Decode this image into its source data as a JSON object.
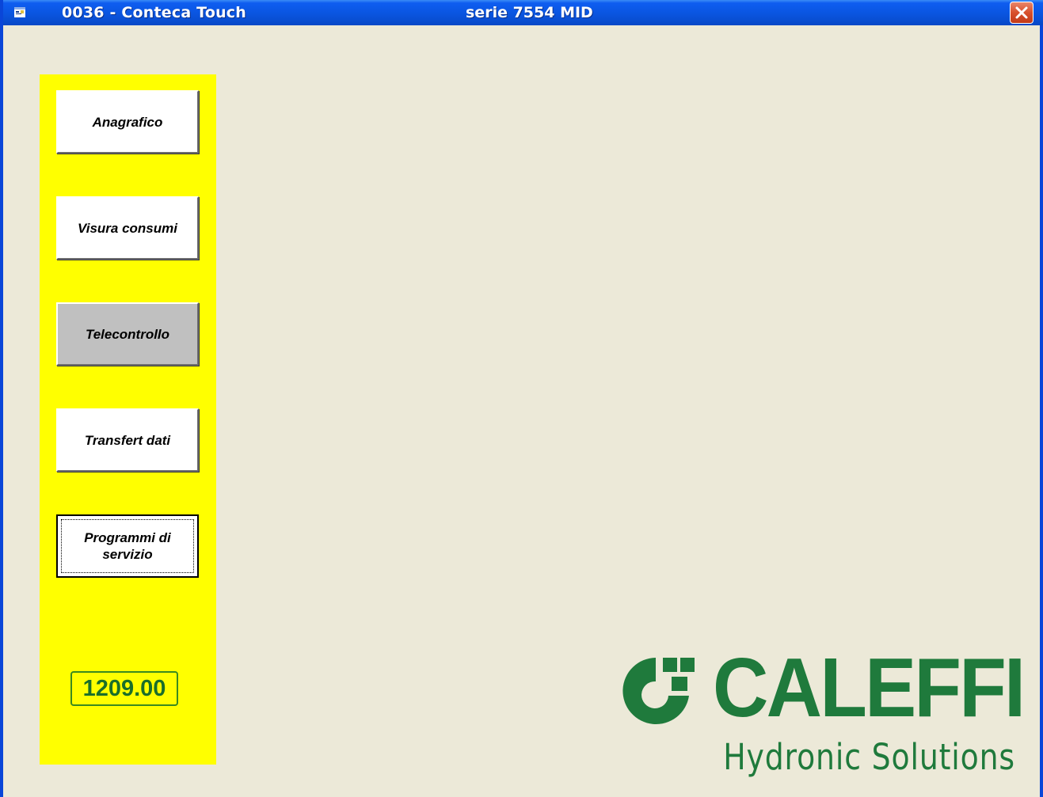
{
  "window": {
    "title": "0036  -  Conteca Touch",
    "subtitle": "serie 7554 MID",
    "close_icon": "close-icon"
  },
  "menu": {
    "anagrafico": "Anagrafico",
    "visura_consumi": "Visura consumi",
    "telecontrollo": "Telecontrollo",
    "transfert_dati": "Transfert dati",
    "programmi_servizio": "Programmi di\nservizio"
  },
  "version": "1209.00",
  "logo": {
    "brand": "CALEFFI",
    "tagline": "Hydronic Solutions"
  },
  "colors": {
    "panel": "#ffff00",
    "brand_green": "#1f7a3c",
    "titlebar": "#0a55e0"
  }
}
